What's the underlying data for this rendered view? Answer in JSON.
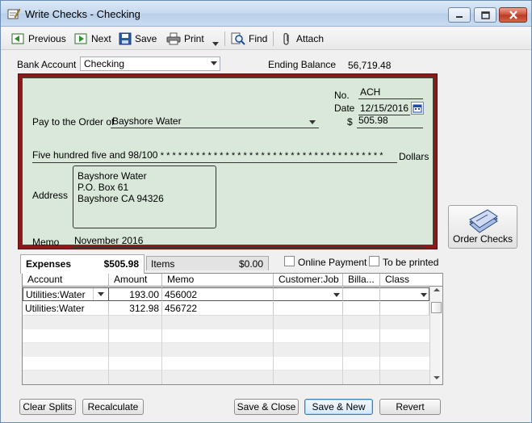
{
  "window": {
    "title": "Write Checks - Checking"
  },
  "toolbar": {
    "previous": "Previous",
    "next": "Next",
    "save": "Save",
    "print": "Print",
    "find": "Find",
    "attach": "Attach"
  },
  "bank": {
    "label": "Bank Account",
    "account": "Checking",
    "ending_balance_label": "Ending Balance",
    "ending_balance": "56,719.48"
  },
  "check": {
    "no_label": "No.",
    "no": "ACH",
    "date_label": "Date",
    "date": "12/15/2016",
    "dollar_sign": "$",
    "amount": "505.98",
    "pay_to_label": "Pay to the Order of",
    "payee": "Bayshore Water",
    "amount_words": "Five hundred five and 98/100",
    "stars": "* * * * * * * * * * * * * * * * * * * * * * * * * * * * * * * * * * * * * *",
    "dollars_label": "Dollars",
    "address_label": "Address",
    "address_lines": [
      "Bayshore Water",
      "P.O. Box 61",
      "Bayshore CA 94326"
    ],
    "memo_label": "Memo",
    "memo": "November 2016"
  },
  "order_checks": {
    "label": "Order Checks"
  },
  "tabs": {
    "expenses_label": "Expenses",
    "expenses_amount": "$505.98",
    "items_label": "Items",
    "items_amount": "$0.00"
  },
  "options": {
    "online_payment": "Online Payment",
    "to_be_printed": "To be printed"
  },
  "grid": {
    "headers": [
      "Account",
      "Amount",
      "Memo",
      "Customer:Job",
      "Billa...",
      "Class"
    ],
    "rows": [
      {
        "account": "Utilities:Water",
        "amount": "193.00",
        "memo": "456002"
      },
      {
        "account": "Utilities:Water",
        "amount": "312.98",
        "memo": "456722"
      }
    ]
  },
  "buttons": {
    "clear_splits": "Clear Splits",
    "recalculate": "Recalculate",
    "save_close": "Save & Close",
    "save_new": "Save & New",
    "revert": "Revert"
  }
}
